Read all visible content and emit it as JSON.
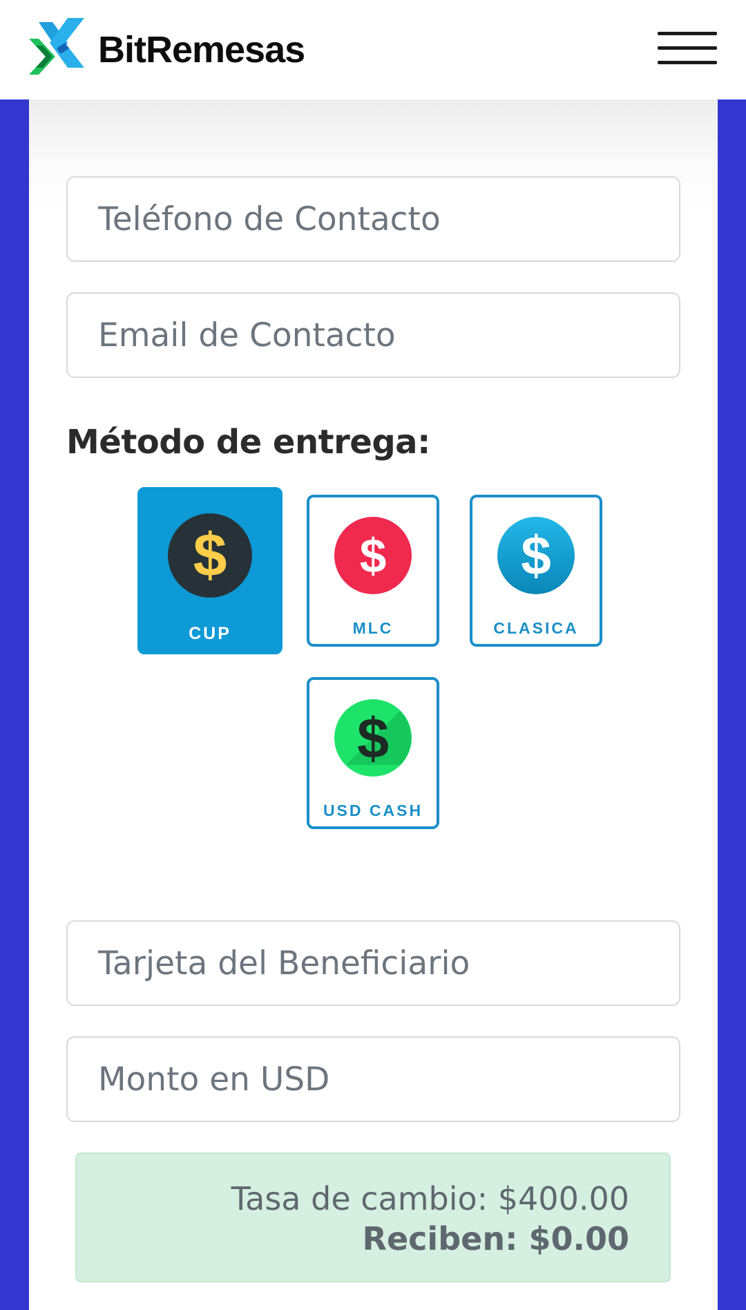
{
  "header": {
    "brand": "BitRemesas",
    "logo_icon": "bitremesas-logo-icon",
    "menu_icon": "hamburger-menu-icon"
  },
  "form": {
    "phone": {
      "placeholder": "Teléfono de Contacto",
      "value": ""
    },
    "email": {
      "placeholder": "Email de Contacto",
      "value": ""
    },
    "delivery_label": "Método de entrega:",
    "delivery_options": [
      {
        "label": "CUP",
        "icon": "dollar-coin-dark-icon",
        "selected": true,
        "color": "#263238"
      },
      {
        "label": "MLC",
        "icon": "dollar-coin-red-icon",
        "selected": false,
        "color": "#f0294f"
      },
      {
        "label": "CLASICA",
        "icon": "dollar-coin-blue-icon",
        "selected": false,
        "color": "#0aa0d8"
      },
      {
        "label": "USD CASH",
        "icon": "dollar-coin-green-icon",
        "selected": false,
        "color": "#1ee36a"
      }
    ],
    "card": {
      "placeholder": "Tarjeta del Beneficiario",
      "value": ""
    },
    "amount": {
      "placeholder": "Monto en USD",
      "value": ""
    }
  },
  "rate": {
    "exchange_text": "Tasa de cambio: $400.00",
    "receive_text": "Reciben: $0.00"
  },
  "colors": {
    "background": "#3436d0",
    "accent": "#0d9ad6",
    "option_border": "#1a8fc8",
    "rate_box": "#d5f0e0"
  }
}
